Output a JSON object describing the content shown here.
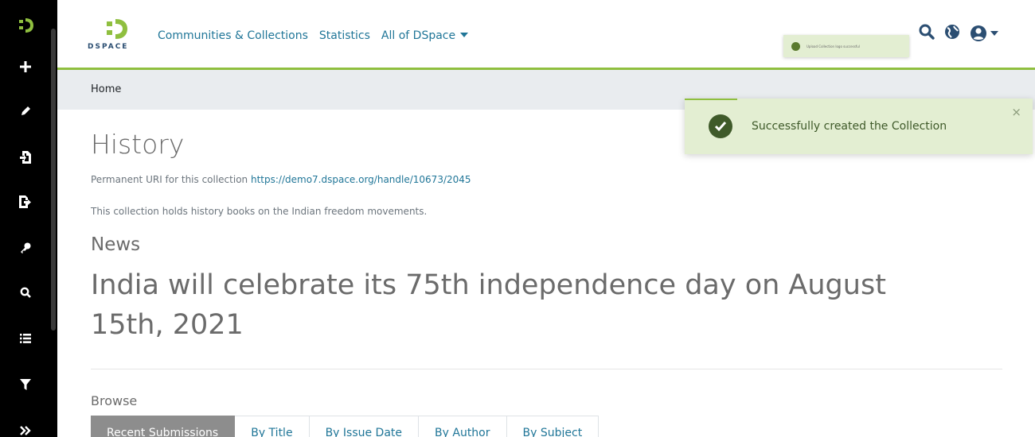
{
  "sidebar": {
    "items": [
      {
        "icon": "dspace-logo-icon"
      },
      {
        "icon": "plus-icon"
      },
      {
        "icon": "pencil-icon"
      },
      {
        "icon": "import-icon"
      },
      {
        "icon": "export-icon"
      },
      {
        "icon": "key-icon"
      },
      {
        "icon": "search-icon"
      },
      {
        "icon": "list-icon"
      },
      {
        "icon": "filter-icon"
      },
      {
        "icon": "expand-icon"
      }
    ]
  },
  "header": {
    "logo_text": "DSPACE",
    "nav": {
      "communities": "Communities & Collections",
      "statistics": "Statistics",
      "all_of_dspace": "All of DSpace"
    },
    "mini_toast_text": "Upload Collection logo successful"
  },
  "breadcrumb": {
    "home": "Home"
  },
  "collection": {
    "title": "History",
    "uri_label": "Permanent URI for this collection",
    "uri": "https://demo7.dspace.org/handle/10673/2045",
    "description": "This collection holds history books on the Indian freedom movements."
  },
  "news": {
    "heading": "News",
    "body": "India will celebrate its 75th independence day on August 15th, 2021"
  },
  "browse": {
    "heading": "Browse",
    "tabs": [
      "Recent Submissions",
      "By Title",
      "By Issue Date",
      "By Author",
      "By Subject"
    ]
  },
  "toast": {
    "message": "Successfully created the Collection",
    "close": "×"
  },
  "colors": {
    "accent_green": "#8fbf3f",
    "link_blue": "#207698",
    "toast_bg": "#e3eed2"
  }
}
